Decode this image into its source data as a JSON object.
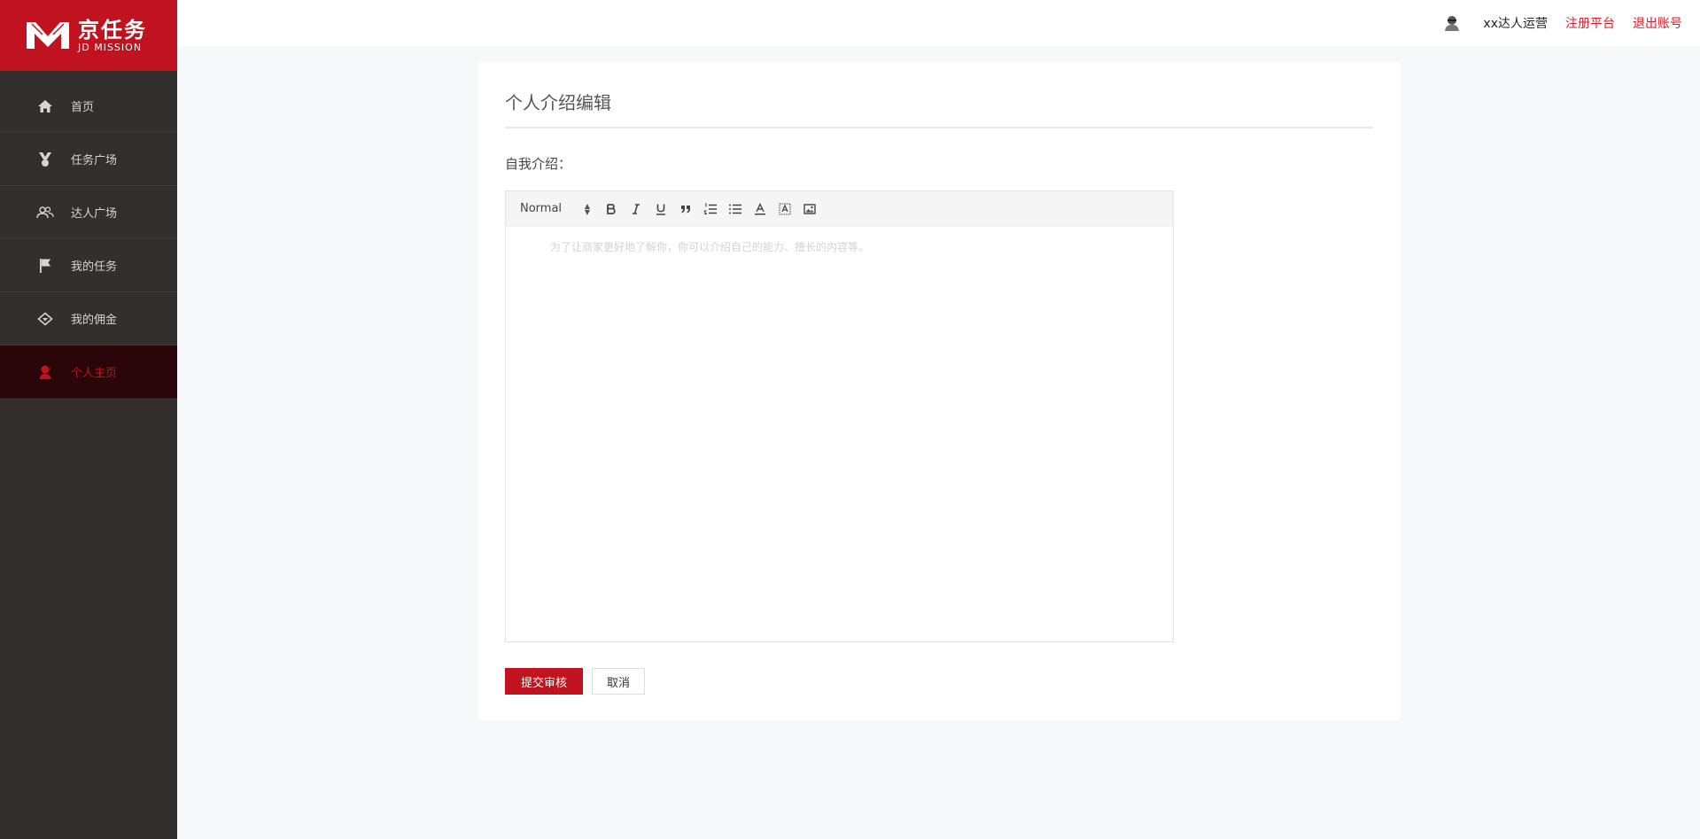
{
  "logo": {
    "cn": "京任务",
    "en": "JD MISSION"
  },
  "sidebar": {
    "items": [
      {
        "label": "首页",
        "icon": "home-icon"
      },
      {
        "label": "任务广场",
        "icon": "medal-icon"
      },
      {
        "label": "达人广场",
        "icon": "people-icon"
      },
      {
        "label": "我的任务",
        "icon": "flag-icon"
      },
      {
        "label": "我的佣金",
        "icon": "diamond-icon"
      },
      {
        "label": "个人主页",
        "icon": "user-icon",
        "active": true
      }
    ]
  },
  "header": {
    "username": "xx达人运营",
    "register_link": "注册平台",
    "logout_link": "退出账号"
  },
  "page": {
    "title": "个人介绍编辑",
    "field_label": "自我介绍：",
    "editor": {
      "format_select": "Normal",
      "toolbar_buttons": [
        "bold-icon",
        "italic-icon",
        "underline-icon",
        "quote-icon",
        "ordered-list-icon",
        "bullet-list-icon",
        "text-color-icon",
        "background-color-icon",
        "image-icon"
      ],
      "placeholder": "为了让商家更好地了解你，你可以介绍自己的能力、擅长的内容等。"
    },
    "submit_button": "提交审核",
    "cancel_button": "取消"
  },
  "colors": {
    "brand": "#c1121f",
    "sidebar_bg": "#332f2e",
    "link": "#d81e2c"
  }
}
